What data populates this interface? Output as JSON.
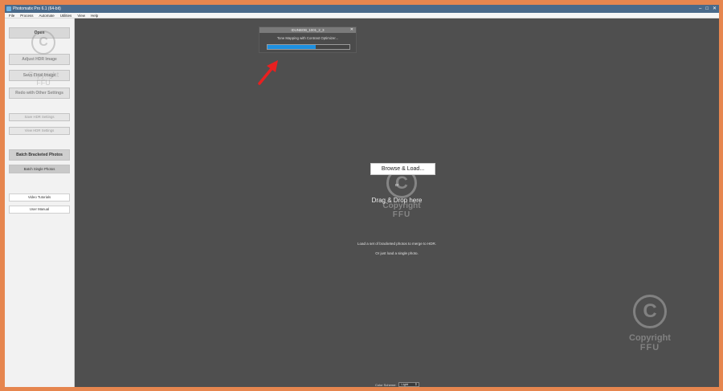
{
  "window": {
    "title": "Photomatix Pro 6.1 (64-bit)",
    "controls": [
      "–",
      "□",
      "✕"
    ]
  },
  "menu": [
    "File",
    "Process",
    "Automate",
    "Utilities",
    "View",
    "Help"
  ],
  "sidebar": {
    "open": "Open",
    "adjust_hdr": "Adjust HDR Image",
    "save_final": "Save Final Image",
    "redo": "Redo with Other Settings",
    "save_hdr_settings": "Save HDR Settings",
    "view_hdr_settings": "View HDR Settings",
    "batch_bracketed": "Batch Bracketed Photos",
    "batch_single": "Batch Single Photos",
    "video_tutorials": "Video Tutorials",
    "user_manual": "User Manual"
  },
  "progress": {
    "title": "IDUNBOB_1001_2_3",
    "close": "✕",
    "message": "Tone Mapping with Contrast Optimizer...",
    "fraction": 0.59,
    "color": "#1e90e0"
  },
  "main": {
    "browse": "Browse & Load...",
    "or": "or",
    "drag": "Drag & Drop here",
    "hint1": "Load a set of bracketed photos to merge to HDR.",
    "hint2": "Or just load a single photo.",
    "color_scheme_label": "Color Scheme:",
    "color_scheme_value": "Light"
  },
  "watermark": {
    "symbol": "C",
    "line1": "Copyright",
    "line2": "FFU"
  },
  "colors": {
    "frame": "#e6864f",
    "main_bg": "#4f4f4f",
    "arrow": "#e82020"
  }
}
